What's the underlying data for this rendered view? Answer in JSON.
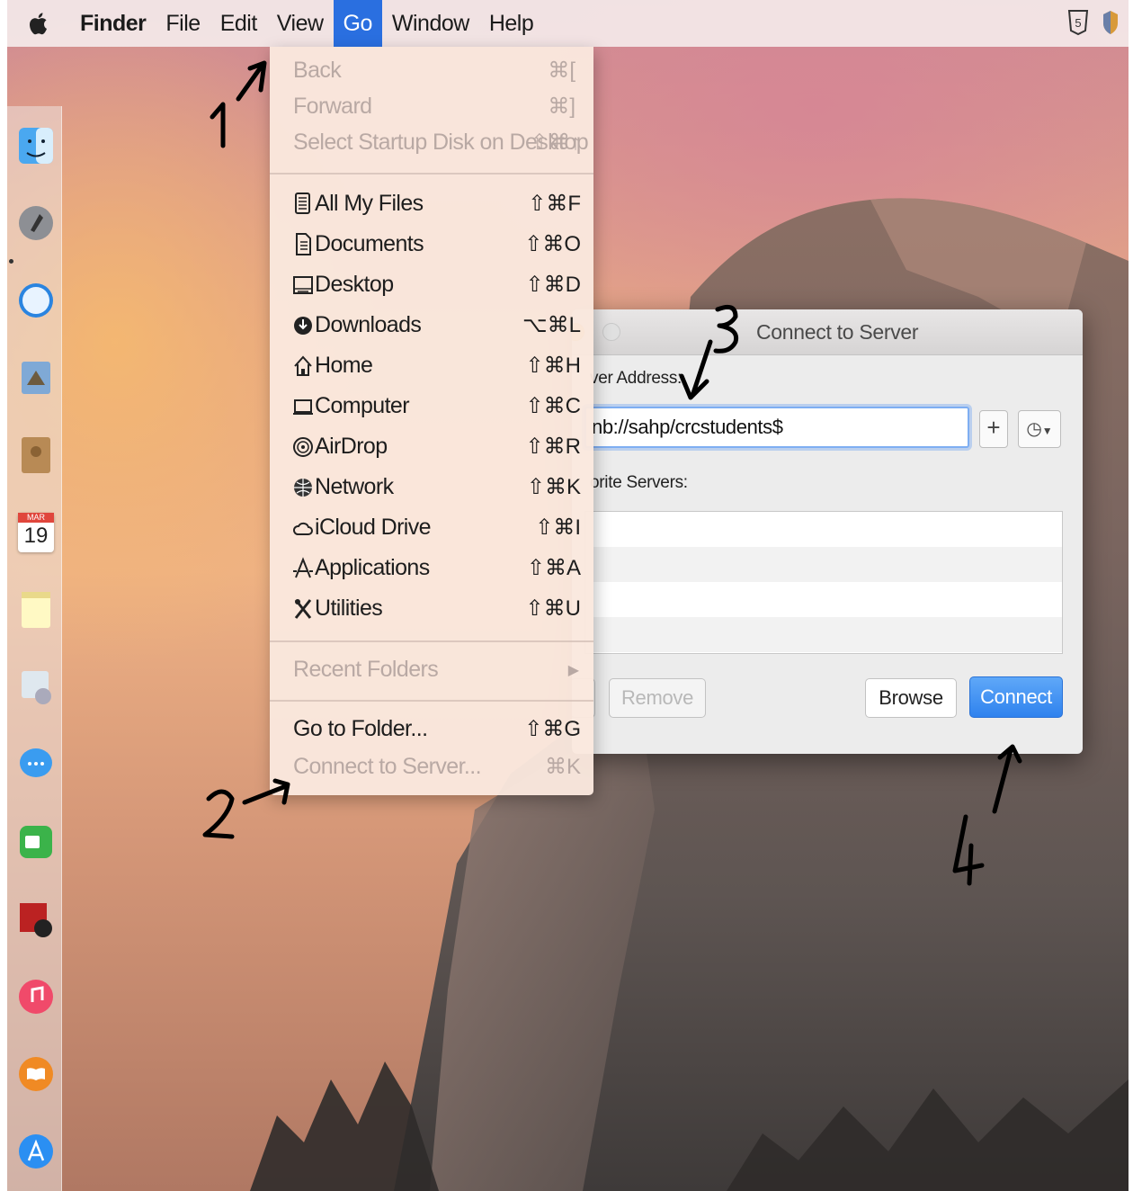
{
  "menubar": {
    "app": "Finder",
    "items": [
      "File",
      "Edit",
      "View",
      "Go",
      "Window",
      "Help"
    ],
    "active": "Go"
  },
  "go_menu": {
    "history": [
      {
        "label": "Back",
        "shortcut": "⌘[",
        "disabled": true
      },
      {
        "label": "Forward",
        "shortcut": "⌘]",
        "disabled": true
      },
      {
        "label": "Select Startup Disk on Desktop",
        "shortcut": "⇧⌘↑",
        "disabled": true
      }
    ],
    "places": [
      {
        "label": "All My Files",
        "shortcut": "⇧⌘F",
        "icon": "all-files-icon"
      },
      {
        "label": "Documents",
        "shortcut": "⇧⌘O",
        "icon": "documents-icon"
      },
      {
        "label": "Desktop",
        "shortcut": "⇧⌘D",
        "icon": "desktop-icon"
      },
      {
        "label": "Downloads",
        "shortcut": "⌥⌘L",
        "icon": "downloads-icon"
      },
      {
        "label": "Home",
        "shortcut": "⇧⌘H",
        "icon": "home-icon"
      },
      {
        "label": "Computer",
        "shortcut": "⇧⌘C",
        "icon": "computer-icon"
      },
      {
        "label": "AirDrop",
        "shortcut": "⇧⌘R",
        "icon": "airdrop-icon"
      },
      {
        "label": "Network",
        "shortcut": "⇧⌘K",
        "icon": "network-icon"
      },
      {
        "label": "iCloud Drive",
        "shortcut": "⇧⌘I",
        "icon": "icloud-icon"
      },
      {
        "label": "Applications",
        "shortcut": "⇧⌘A",
        "icon": "applications-icon"
      },
      {
        "label": "Utilities",
        "shortcut": "⇧⌘U",
        "icon": "utilities-icon"
      }
    ],
    "recent_folders": "Recent Folders",
    "go_to_folder": {
      "label": "Go to Folder...",
      "shortcut": "⇧⌘G"
    },
    "connect_to_server": {
      "label": "Connect to Server...",
      "shortcut": "⌘K"
    }
  },
  "dialog": {
    "title": "Connect to Server",
    "server_address_label": "ver Address:",
    "server_address_value": "nb://sahp/crcstudents$",
    "plus_label": "+",
    "favorite_servers_label": "orite Servers:",
    "remove_label": "Remove",
    "browse_label": "Browse",
    "connect_label": "Connect"
  },
  "dock": {
    "calendar_month": "MAR",
    "calendar_day": "19"
  },
  "colors": {
    "accent": "#2a6fe0",
    "connect_button": "#3a8cf2"
  }
}
